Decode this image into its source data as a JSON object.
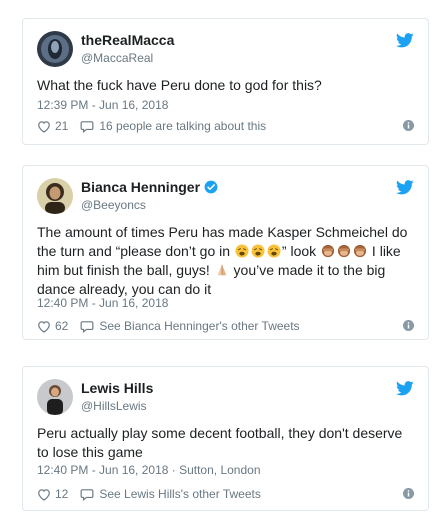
{
  "tweets": [
    {
      "display_name": "theRealMacca",
      "handle": "@MaccaReal",
      "verified": false,
      "text": "What the fuck have Peru done to god for this?",
      "timestamp": "12:39 PM - Jun 16, 2018",
      "likes": "21",
      "action_text": "16 people are talking about this"
    },
    {
      "display_name": "Bianca Henninger",
      "handle": "@Beeyoncs",
      "verified": true,
      "text_part1": "The amount of times Peru has made Kasper Schmeichel do the turn and “please don’t go in ",
      "text_part2": "” look ",
      "text_part3": " I like him but finish the ball, guys! ",
      "text_part4": " you’ve made it to the big dance already, you can do it",
      "timestamp": "12:40 PM - Jun 16, 2018",
      "likes": "62",
      "action_text": "See Bianca Henninger's other Tweets"
    },
    {
      "display_name": "Lewis Hills",
      "handle": "@HillsLewis",
      "verified": false,
      "text": "Peru actually play some decent football, they don't deserve to lose this game",
      "timestamp": "12:40 PM - Jun 16, 2018 · Sutton, London",
      "likes": "12",
      "action_text": "See Lewis Hills's other Tweets"
    }
  ],
  "icons": {
    "bird": "twitter-bird-icon",
    "heart": "heart-icon",
    "bubble": "speech-bubble-icon",
    "info": "info-icon",
    "verified": "verified-badge-icon",
    "weary": "weary-face-emoji",
    "see_no_evil": "see-no-evil-monkey-emoji",
    "pray": "folded-hands-emoji"
  },
  "colors": {
    "twitter_blue": "#1da1f2",
    "meta_gray": "#697882",
    "border": "#e1e8ed"
  }
}
